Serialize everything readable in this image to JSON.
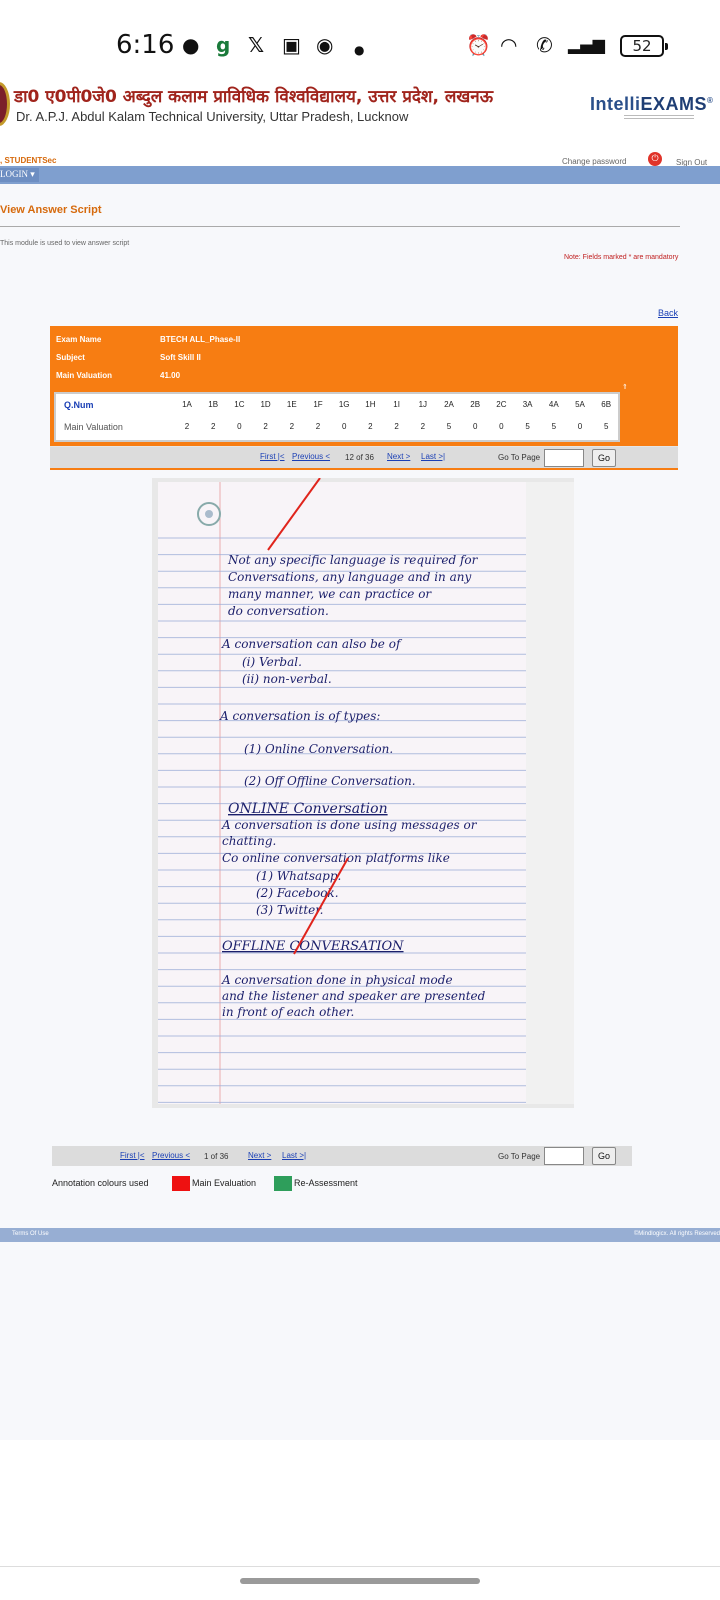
{
  "status_bar": {
    "time": "6:16",
    "battery": "52",
    "left_icons": [
      "chat-icon",
      "g-icon",
      "x-icon",
      "instagram-icon",
      "chrome-icon",
      "dot-icon"
    ],
    "right_icons": [
      "alarm-icon",
      "wifi-icon",
      "call-icon",
      "signal-icon"
    ]
  },
  "header": {
    "hindi_title": "डा0 ए0पी0जे0 अब्दुल कलाम प्राविधिक विश्वविद्यालय, उत्तर प्रदेश, लखनऊ",
    "english_title": "Dr. A.P.J. Abdul Kalam Technical University, Uttar Pradesh, Lucknow",
    "brand_part1": "Intelli",
    "brand_part2": "EXAMS",
    "brand_mark": "®"
  },
  "userbar": {
    "username": ", STUDENTSec",
    "change_password": "Change password",
    "sign_out": "Sign Out"
  },
  "nav": {
    "login": "LOGIN ▾"
  },
  "page": {
    "heading": "View Answer Script",
    "description": "This module is used to view answer script",
    "mandatory_note": "Note: Fields marked * are mandatory",
    "back": "Back"
  },
  "exam_info": {
    "exam_name_label": "Exam Name",
    "exam_name": "BTECH ALL_Phase-II",
    "subject_label": "Subject",
    "subject": "Soft Skill II",
    "valuation_label": "Main Valuation",
    "valuation": "41.00",
    "collapse_arrows": "⇑"
  },
  "marks_table": {
    "qnum_label": "Q.Num",
    "main_valuation_label": "Main Valuation",
    "questions": [
      "1A",
      "1B",
      "1C",
      "1D",
      "1E",
      "1F",
      "1G",
      "1H",
      "1I",
      "1J",
      "2A",
      "2B",
      "2C",
      "3A",
      "4A",
      "5A",
      "6B"
    ],
    "marks": [
      "2",
      "2",
      "0",
      "2",
      "2",
      "2",
      "0",
      "2",
      "2",
      "2",
      "5",
      "0",
      "0",
      "5",
      "5",
      "0",
      "5"
    ]
  },
  "pager_top": {
    "first": "First |<",
    "previous": "Previous <",
    "page_info": "12 of 36",
    "next": "Next >",
    "last": "Last >|",
    "goto_label": "Go To Page",
    "go": "Go"
  },
  "script_text": {
    "line1": "Not any specific language is required for",
    "line2": "Conversations, any language and in any",
    "line3": "many manner, we can practice or",
    "line4": "do conversation.",
    "line5": "A conversation can also be of",
    "line6": "(i) Verbal.",
    "line7": "(ii) non-verbal.",
    "line8": "A conversation is of types:",
    "line9": "(1) Online Conversation.",
    "line10": "(2) Off Offline Conversation.",
    "heading1": "ONLINE Conversation",
    "line11": "A conversation is done using messages or",
    "line12": "chatting.",
    "line13": "Co online conversation platforms like",
    "line14": "(1) Whatsapp.",
    "line15": "(2) Facebook.",
    "line16": "(3) Twitter.",
    "heading2": "OFFLINE CONVERSATION",
    "line17": "A conversation done in physical mode",
    "line18": "and the listener and speaker are presented",
    "line19": "in front of each other."
  },
  "pager_bottom": {
    "first": "First |<",
    "previous": "Previous <",
    "page_info": "1 of 36",
    "next": "Next >",
    "last": "Last >|",
    "goto_label": "Go To Page",
    "go": "Go"
  },
  "legend": {
    "label": "Annotation colours used",
    "main": "Main Evaluation",
    "reassess": "Re-Assessment",
    "main_color": "#ee1111",
    "reassess_color": "#2e9e5b"
  },
  "footer": {
    "terms": "Terms Of Use",
    "copyright": "©Mindlogicx. All rights Reserved"
  },
  "colors": {
    "accent_orange": "#f77d12",
    "nav_blue": "#7f9fcf",
    "link_blue": "#1a3fb5",
    "heading_orange": "#d66a0d"
  }
}
